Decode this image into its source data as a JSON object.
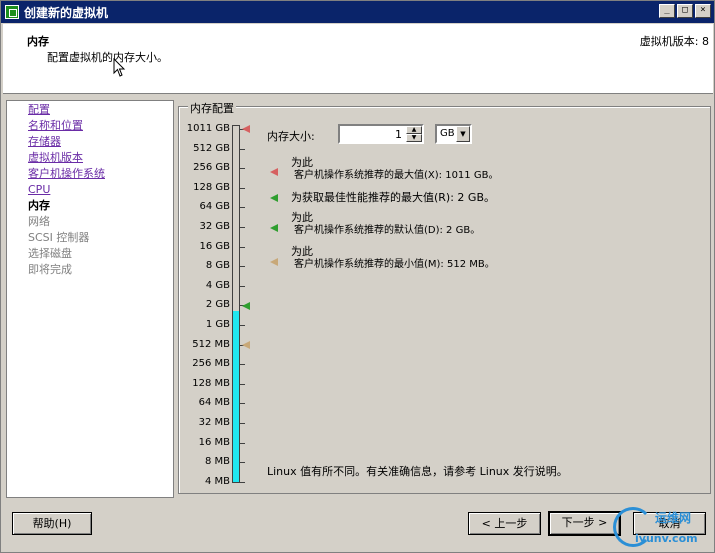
{
  "window": {
    "title": "创建新的虚拟机",
    "buttons": [
      "_",
      "□",
      "×"
    ]
  },
  "header": {
    "title": "内存",
    "subtitle": "配置虚拟机的内存大小。",
    "version": "虚拟机版本: 8"
  },
  "nav": {
    "items": [
      {
        "label": "配置",
        "state": "link"
      },
      {
        "label": "名称和位置",
        "state": "link"
      },
      {
        "label": "存储器",
        "state": "link"
      },
      {
        "label": "虚拟机版本",
        "state": "link"
      },
      {
        "label": "客户机操作系统",
        "state": "link"
      },
      {
        "label": "CPU",
        "state": "link"
      },
      {
        "label": "内存",
        "state": "current"
      },
      {
        "label": "网络",
        "state": "disabled"
      },
      {
        "label": "SCSI 控制器",
        "state": "disabled"
      },
      {
        "label": "选择磁盘",
        "state": "disabled"
      },
      {
        "label": "即将完成",
        "state": "disabled"
      }
    ]
  },
  "memory": {
    "group_label": "内存配置",
    "size_label": "内存大小:",
    "size_value": "1",
    "unit": "GB",
    "scale": [
      "1011 GB",
      "512 GB",
      "256 GB",
      "128 GB",
      "64 GB",
      "32 GB",
      "16 GB",
      "8 GB",
      "4 GB",
      "2 GB",
      "1 GB",
      "512 MB",
      "256 MB",
      "128 MB",
      "64 MB",
      "32 MB",
      "16 MB",
      "8 MB",
      "4 MB"
    ],
    "selected_scale_index": 10,
    "legend": {
      "max_line1": "为此",
      "max_line2": "客户机操作系统推荐的最大值(X): 1011 GB。",
      "best": "为获取最佳性能推荐的最大值(R): 2 GB。",
      "default_line1": "为此",
      "default_line2": "客户机操作系统推荐的默认值(D): 2 GB。",
      "min_line1": "为此",
      "min_line2": "客户机操作系统推荐的最小值(M): 512 MB。"
    },
    "note": "Linux 值有所不同。有关准确信息，请参考 Linux 发行说明。",
    "colors": {
      "fill": "#1fe6f0",
      "max": "#d66060",
      "best": "#2f9e2f",
      "default": "#2f9e2f",
      "min": "#c8a878"
    }
  },
  "footer": {
    "help": "帮助(H)",
    "back": "< 上一步",
    "next": "下一步 >",
    "cancel": "取消"
  },
  "watermark": {
    "line1": "运维网",
    "line2": "iyunv.com"
  }
}
